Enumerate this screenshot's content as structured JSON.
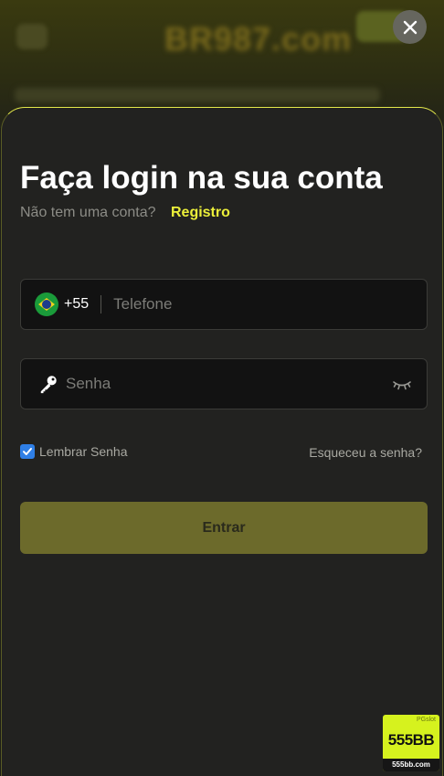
{
  "background": {
    "logo_text": "BR987.com"
  },
  "modal": {
    "title": "Faça login na sua conta",
    "no_account_text": "Não tem uma conta?",
    "register_link": "Registro",
    "phone": {
      "country_code": "+55",
      "flag_icon": "brazil-flag-icon",
      "placeholder": "Telefone",
      "value": ""
    },
    "password": {
      "key_icon": "key-icon",
      "placeholder": "Senha",
      "value": "",
      "visibility_icon": "eye-closed-icon"
    },
    "remember_label": "Lembrar Senha",
    "remember_checked": true,
    "forgot_link": "Esqueceu a senha?",
    "submit_label": "Entrar"
  },
  "badge": {
    "top_text": "PGslot",
    "title": "555BB",
    "url": "555bb.com"
  },
  "colors": {
    "accent": "#ecf03a",
    "panel_bg": "#222220",
    "button_bg": "#6c6a2b",
    "checkbox": "#2f7fe6"
  }
}
